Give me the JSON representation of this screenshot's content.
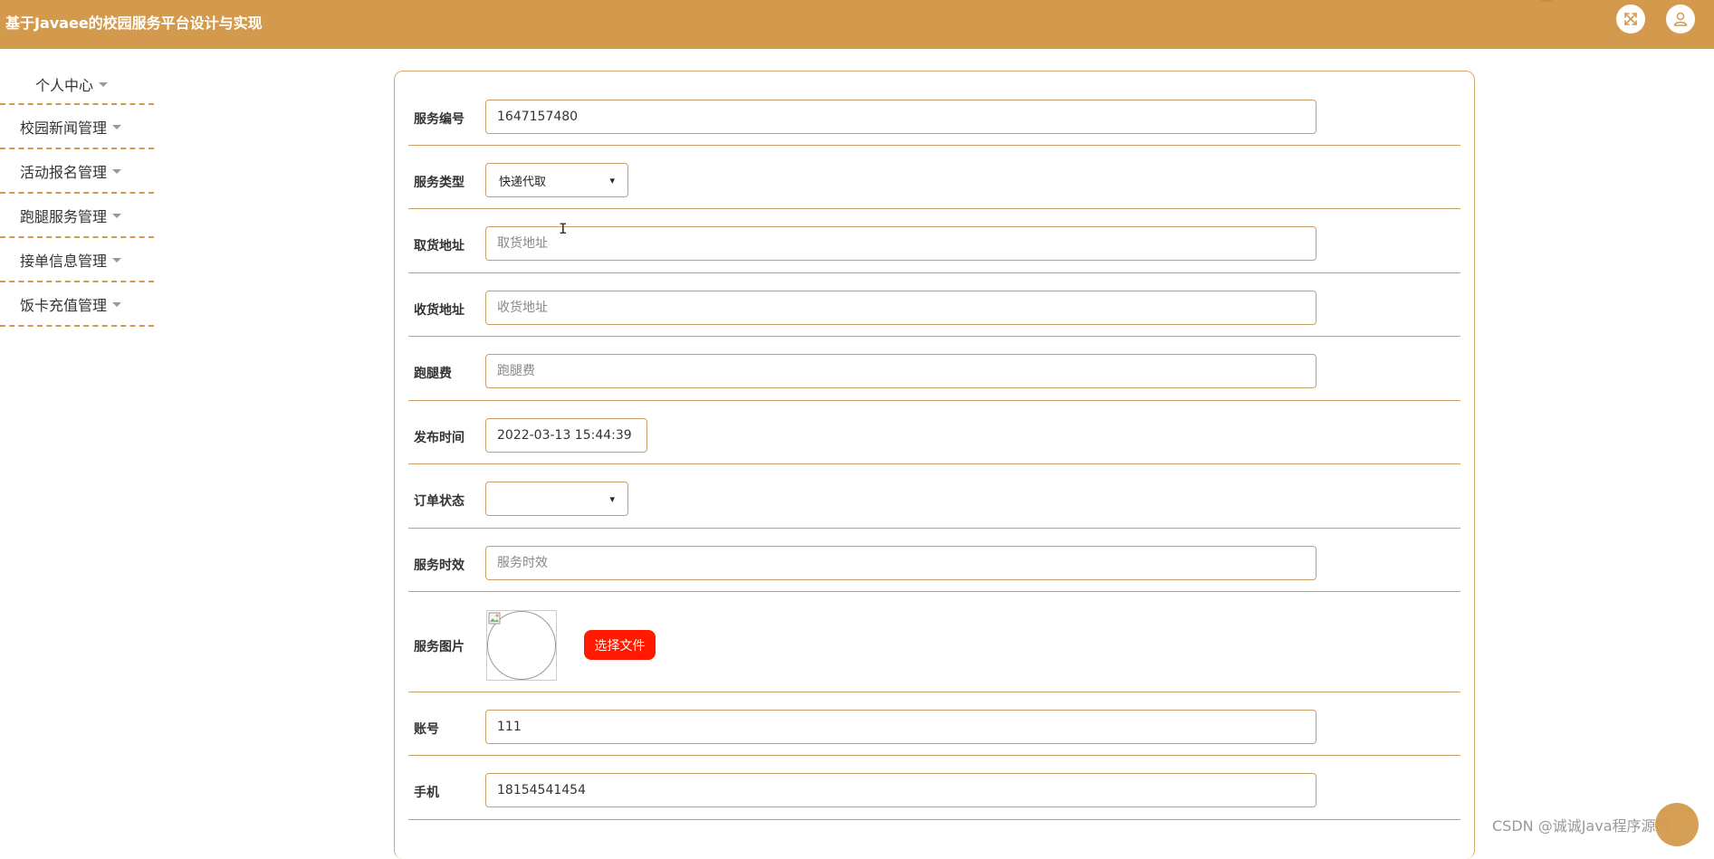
{
  "header": {
    "title": "基于Javaee的校园服务平台设计与实现",
    "fullscreen_icon": "expand-arrows-icon",
    "user_icon": "user-icon"
  },
  "sidebar": {
    "items": [
      {
        "label": "个人中心"
      },
      {
        "label": "校园新闻管理"
      },
      {
        "label": "活动报名管理"
      },
      {
        "label": "跑腿服务管理"
      },
      {
        "label": "接单信息管理"
      },
      {
        "label": "饭卡充值管理"
      }
    ]
  },
  "form": {
    "service_no": {
      "label": "服务编号",
      "value": "1647157480"
    },
    "service_type": {
      "label": "服务类型",
      "selected": "快递代取"
    },
    "pickup_address": {
      "label": "取货地址",
      "placeholder": "取货地址"
    },
    "delivery_address": {
      "label": "收货地址",
      "placeholder": "收货地址"
    },
    "fee": {
      "label": "跑腿费",
      "placeholder": "跑腿费"
    },
    "publish_time": {
      "label": "发布时间",
      "value": "2022-03-13 15:44:39"
    },
    "order_status": {
      "label": "订单状态",
      "selected": ""
    },
    "service_time": {
      "label": "服务时效",
      "placeholder": "服务时效"
    },
    "service_image": {
      "label": "服务图片",
      "button": "选择文件"
    },
    "account": {
      "label": "账号",
      "value": "111"
    },
    "phone": {
      "label": "手机",
      "value": "18154541454"
    }
  },
  "watermark": "CSDN @诚诚Java程序源码",
  "colors": {
    "accent": "#d39a4d",
    "file_button": "#ff1a00"
  }
}
